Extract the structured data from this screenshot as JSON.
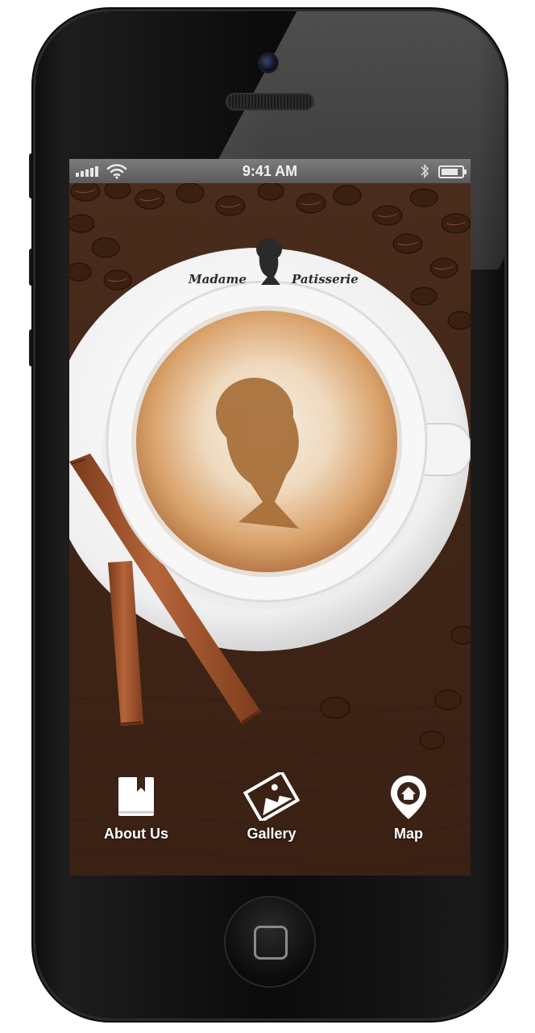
{
  "status_bar": {
    "time": "9:41 AM",
    "signal_bars": 5,
    "battery_level": 0.85
  },
  "brand": {
    "left_text": "Madame",
    "right_text": "Patisserie"
  },
  "bottom_nav": {
    "items": [
      {
        "label": "About Us",
        "icon": "book-icon"
      },
      {
        "label": "Gallery",
        "icon": "gallery-image-icon"
      },
      {
        "label": "Map",
        "icon": "map-pin-home-icon"
      }
    ]
  },
  "colors": {
    "status_bar": "#6a6a6a",
    "nav_text": "#ffffff",
    "wood": "#4a2c1c",
    "foam": "#d9a26b",
    "cinnamon": "#a0522d"
  }
}
